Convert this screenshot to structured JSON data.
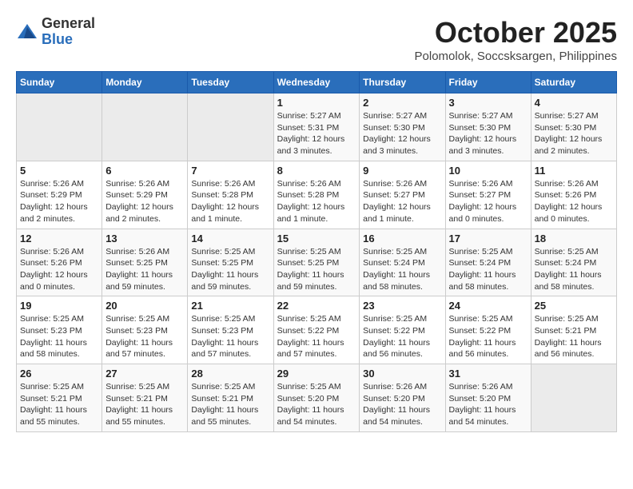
{
  "header": {
    "logo_general": "General",
    "logo_blue": "Blue",
    "month": "October 2025",
    "location": "Polomolok, Soccsksargen, Philippines"
  },
  "days_of_week": [
    "Sunday",
    "Monday",
    "Tuesday",
    "Wednesday",
    "Thursday",
    "Friday",
    "Saturday"
  ],
  "weeks": [
    [
      {
        "day": "",
        "info": ""
      },
      {
        "day": "",
        "info": ""
      },
      {
        "day": "",
        "info": ""
      },
      {
        "day": "1",
        "info": "Sunrise: 5:27 AM\nSunset: 5:31 PM\nDaylight: 12 hours and 3 minutes."
      },
      {
        "day": "2",
        "info": "Sunrise: 5:27 AM\nSunset: 5:30 PM\nDaylight: 12 hours and 3 minutes."
      },
      {
        "day": "3",
        "info": "Sunrise: 5:27 AM\nSunset: 5:30 PM\nDaylight: 12 hours and 3 minutes."
      },
      {
        "day": "4",
        "info": "Sunrise: 5:27 AM\nSunset: 5:30 PM\nDaylight: 12 hours and 2 minutes."
      }
    ],
    [
      {
        "day": "5",
        "info": "Sunrise: 5:26 AM\nSunset: 5:29 PM\nDaylight: 12 hours and 2 minutes."
      },
      {
        "day": "6",
        "info": "Sunrise: 5:26 AM\nSunset: 5:29 PM\nDaylight: 12 hours and 2 minutes."
      },
      {
        "day": "7",
        "info": "Sunrise: 5:26 AM\nSunset: 5:28 PM\nDaylight: 12 hours and 1 minute."
      },
      {
        "day": "8",
        "info": "Sunrise: 5:26 AM\nSunset: 5:28 PM\nDaylight: 12 hours and 1 minute."
      },
      {
        "day": "9",
        "info": "Sunrise: 5:26 AM\nSunset: 5:27 PM\nDaylight: 12 hours and 1 minute."
      },
      {
        "day": "10",
        "info": "Sunrise: 5:26 AM\nSunset: 5:27 PM\nDaylight: 12 hours and 0 minutes."
      },
      {
        "day": "11",
        "info": "Sunrise: 5:26 AM\nSunset: 5:26 PM\nDaylight: 12 hours and 0 minutes."
      }
    ],
    [
      {
        "day": "12",
        "info": "Sunrise: 5:26 AM\nSunset: 5:26 PM\nDaylight: 12 hours and 0 minutes."
      },
      {
        "day": "13",
        "info": "Sunrise: 5:26 AM\nSunset: 5:25 PM\nDaylight: 11 hours and 59 minutes."
      },
      {
        "day": "14",
        "info": "Sunrise: 5:25 AM\nSunset: 5:25 PM\nDaylight: 11 hours and 59 minutes."
      },
      {
        "day": "15",
        "info": "Sunrise: 5:25 AM\nSunset: 5:25 PM\nDaylight: 11 hours and 59 minutes."
      },
      {
        "day": "16",
        "info": "Sunrise: 5:25 AM\nSunset: 5:24 PM\nDaylight: 11 hours and 58 minutes."
      },
      {
        "day": "17",
        "info": "Sunrise: 5:25 AM\nSunset: 5:24 PM\nDaylight: 11 hours and 58 minutes."
      },
      {
        "day": "18",
        "info": "Sunrise: 5:25 AM\nSunset: 5:24 PM\nDaylight: 11 hours and 58 minutes."
      }
    ],
    [
      {
        "day": "19",
        "info": "Sunrise: 5:25 AM\nSunset: 5:23 PM\nDaylight: 11 hours and 58 minutes."
      },
      {
        "day": "20",
        "info": "Sunrise: 5:25 AM\nSunset: 5:23 PM\nDaylight: 11 hours and 57 minutes."
      },
      {
        "day": "21",
        "info": "Sunrise: 5:25 AM\nSunset: 5:23 PM\nDaylight: 11 hours and 57 minutes."
      },
      {
        "day": "22",
        "info": "Sunrise: 5:25 AM\nSunset: 5:22 PM\nDaylight: 11 hours and 57 minutes."
      },
      {
        "day": "23",
        "info": "Sunrise: 5:25 AM\nSunset: 5:22 PM\nDaylight: 11 hours and 56 minutes."
      },
      {
        "day": "24",
        "info": "Sunrise: 5:25 AM\nSunset: 5:22 PM\nDaylight: 11 hours and 56 minutes."
      },
      {
        "day": "25",
        "info": "Sunrise: 5:25 AM\nSunset: 5:21 PM\nDaylight: 11 hours and 56 minutes."
      }
    ],
    [
      {
        "day": "26",
        "info": "Sunrise: 5:25 AM\nSunset: 5:21 PM\nDaylight: 11 hours and 55 minutes."
      },
      {
        "day": "27",
        "info": "Sunrise: 5:25 AM\nSunset: 5:21 PM\nDaylight: 11 hours and 55 minutes."
      },
      {
        "day": "28",
        "info": "Sunrise: 5:25 AM\nSunset: 5:21 PM\nDaylight: 11 hours and 55 minutes."
      },
      {
        "day": "29",
        "info": "Sunrise: 5:25 AM\nSunset: 5:20 PM\nDaylight: 11 hours and 54 minutes."
      },
      {
        "day": "30",
        "info": "Sunrise: 5:26 AM\nSunset: 5:20 PM\nDaylight: 11 hours and 54 minutes."
      },
      {
        "day": "31",
        "info": "Sunrise: 5:26 AM\nSunset: 5:20 PM\nDaylight: 11 hours and 54 minutes."
      },
      {
        "day": "",
        "info": ""
      }
    ]
  ]
}
